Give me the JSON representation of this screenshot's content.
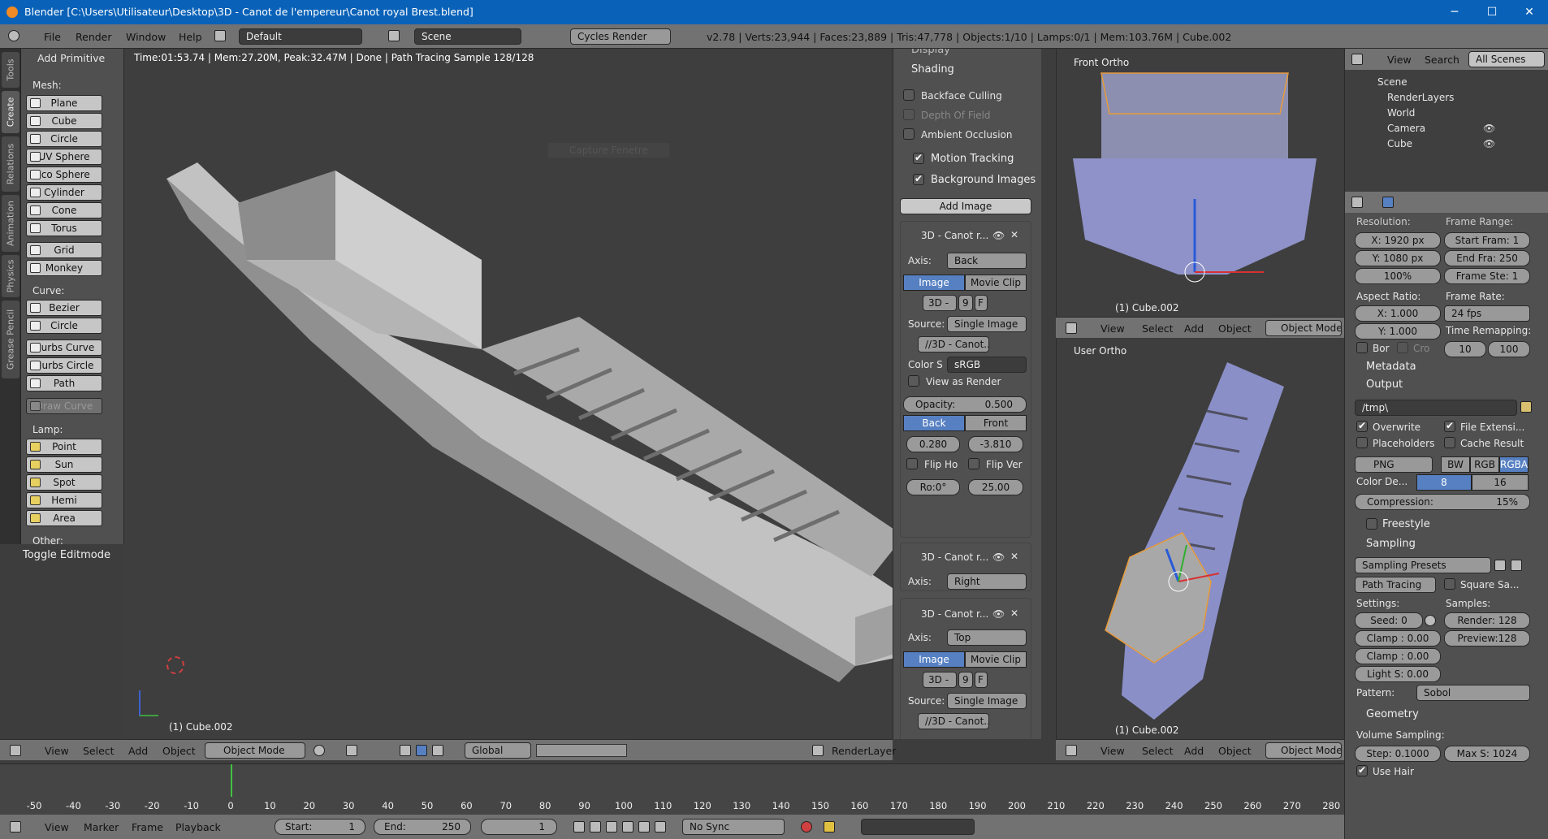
{
  "window": {
    "title": "Blender [C:\\Users\\Utilisateur\\Desktop\\3D - Canot de l'empereur\\Canot royal Brest.blend]",
    "min": "─",
    "max": "☐",
    "close": "✕"
  },
  "menu": {
    "file": "File",
    "render": "Render",
    "window": "Window",
    "help": "Help",
    "layout": "Default",
    "scene": "Scene",
    "engine": "Cycles Render",
    "stats": "v2.78 | Verts:23,944 | Faces:23,889 | Tris:47,778 | Objects:1/10 | Lamps:0/1 | Mem:103.76M | Cube.002"
  },
  "sidebar_tabs": [
    "Tools",
    "Create",
    "Relations",
    "Animation",
    "Physics",
    "Grease Pencil"
  ],
  "toolshelf": {
    "header": "Add Primitive",
    "mesh_label": "Mesh:",
    "mesh": [
      "Plane",
      "Cube",
      "Circle",
      "UV Sphere",
      "Ico Sphere",
      "Cylinder",
      "Cone",
      "Torus",
      "Grid",
      "Monkey"
    ],
    "curve_label": "Curve:",
    "curve": [
      "Bezier",
      "Circle",
      "Nurbs Curve",
      "Nurbs Circle",
      "Path"
    ],
    "draw_curve": "Draw Curve",
    "lamp_label": "Lamp:",
    "lamp": [
      "Point",
      "Sun",
      "Spot",
      "Hemi",
      "Area"
    ],
    "other_label": "Other:",
    "toggle": "Toggle Editmode"
  },
  "main_viewport": {
    "status": "Time:01:53.74 | Mem:27.20M, Peak:32.47M | Done | Path Tracing Sample 128/128",
    "object": "(1) Cube.002",
    "tooltip": "Capture Fenetre",
    "header": {
      "view": "View",
      "select": "Select",
      "add": "Add",
      "object": "Object",
      "mode": "Object Mode",
      "orientation": "Global",
      "layer": "RenderLayer"
    }
  },
  "properties": {
    "display": "Display",
    "shading": "Shading",
    "backface": "Backface Culling",
    "dof": "Depth Of Field",
    "ao": "Ambient Occlusion",
    "motion": "Motion Tracking",
    "bgimages": "Background Images",
    "add_image": "Add Image",
    "img1": {
      "name": "3D - Canot r...",
      "axis_label": "Axis:",
      "axis": "Back",
      "image": "Image",
      "movie": "Movie Clip",
      "file": "3D -",
      "num": "9",
      "f": "F",
      "source_label": "Source:",
      "source": "Single Image",
      "path": "//3D - Canot...",
      "color_label": "Color S",
      "color": "sRGB",
      "view_render": "View as Render",
      "opacity_label": "Opacity:",
      "opacity": "0.500",
      "back": "Back",
      "front": "Front",
      "x": "0.280",
      "y": "-3.810",
      "fliph": "Flip Ho",
      "flipv": "Flip Ver",
      "rot": "Ro:0°",
      "size": "25.00"
    },
    "img2": {
      "name": "3D - Canot r...",
      "axis_label": "Axis:",
      "axis": "Right"
    },
    "img3": {
      "name": "3D - Canot r...",
      "axis_label": "Axis:",
      "axis": "Top",
      "image": "Image",
      "movie": "Movie Clip",
      "file": "3D -",
      "num": "9",
      "f": "F",
      "source_label": "Source:",
      "source": "Single Image",
      "path": "//3D - Canot..."
    }
  },
  "front_viewport": {
    "label": "Front Ortho",
    "object": "(1) Cube.002",
    "header": {
      "view": "View",
      "select": "Select",
      "add": "Add",
      "object": "Object",
      "mode": "Object Mode"
    }
  },
  "user_viewport": {
    "label": "User Ortho",
    "object": "(1) Cube.002",
    "header": {
      "view": "View",
      "select": "Select",
      "add": "Add",
      "object": "Object",
      "mode": "Object Mode"
    }
  },
  "outliner": {
    "view": "View",
    "search": "Search",
    "filter": "All Scenes",
    "items": [
      "Scene",
      "RenderLayers",
      "World",
      "Camera",
      "Cube"
    ]
  },
  "render_props": {
    "resolution": "Resolution:",
    "res_x": "X:  1920 px",
    "res_y": "Y:  1080 px",
    "res_pct": "100%",
    "frame_range": "Frame Range:",
    "start": "Start Fram: 1",
    "end": "End Fra: 250",
    "step": "Frame Ste: 1",
    "aspect": "Aspect Ratio:",
    "asp_x": "X:      1.000",
    "asp_y": "Y:      1.000",
    "frame_rate": "Frame Rate:",
    "fps": "24 fps",
    "time_remap": "Time Remapping:",
    "bor": "Bor",
    "cro": "Cro",
    "remap_old": "10",
    "remap_new": "100",
    "metadata": "Metadata",
    "output": "Output",
    "path": "/tmp\\",
    "overwrite": "Overwrite",
    "file_ext": "File Extensi...",
    "placeholders": "Placeholders",
    "cache": "Cache Result",
    "format": "PNG",
    "bw": "BW",
    "rgb": "RGB",
    "rgba": "RGBA",
    "color_depth": "Color De...",
    "depth8": "8",
    "depth16": "16",
    "compression": "Compression:",
    "compression_val": "15%",
    "freestyle": "Freestyle",
    "sampling": "Sampling",
    "presets": "Sampling Presets",
    "path_tracing": "Path Tracing",
    "square": "Square Sa...",
    "settings": "Settings:",
    "samples": "Samples:",
    "seed": "Seed:  0",
    "clamp1": "Clamp : 0.00",
    "clamp2": "Clamp : 0.00",
    "lights": "Light S: 0.00",
    "render": "Render: 128",
    "preview": "Preview:128",
    "pattern_label": "Pattern:",
    "pattern": "Sobol",
    "geometry": "Geometry",
    "volume": "Volume Sampling:",
    "vstep": "Step: 0.1000",
    "vmax": "Max S: 1024",
    "hair": "Use Hair"
  },
  "timeline": {
    "ticks": [
      "-50",
      "-40",
      "-30",
      "-20",
      "-10",
      "0",
      "10",
      "20",
      "30",
      "40",
      "50",
      "60",
      "70",
      "80",
      "90",
      "100",
      "110",
      "120",
      "130",
      "140",
      "150",
      "160",
      "170",
      "180",
      "190",
      "200",
      "210",
      "220",
      "230",
      "240",
      "250",
      "260",
      "270",
      "280"
    ],
    "view": "View",
    "marker": "Marker",
    "frame": "Frame",
    "playback": "Playback",
    "start": "Start:",
    "start_val": "1",
    "end": "End:",
    "end_val": "250",
    "current": "1",
    "sync": "No Sync"
  }
}
